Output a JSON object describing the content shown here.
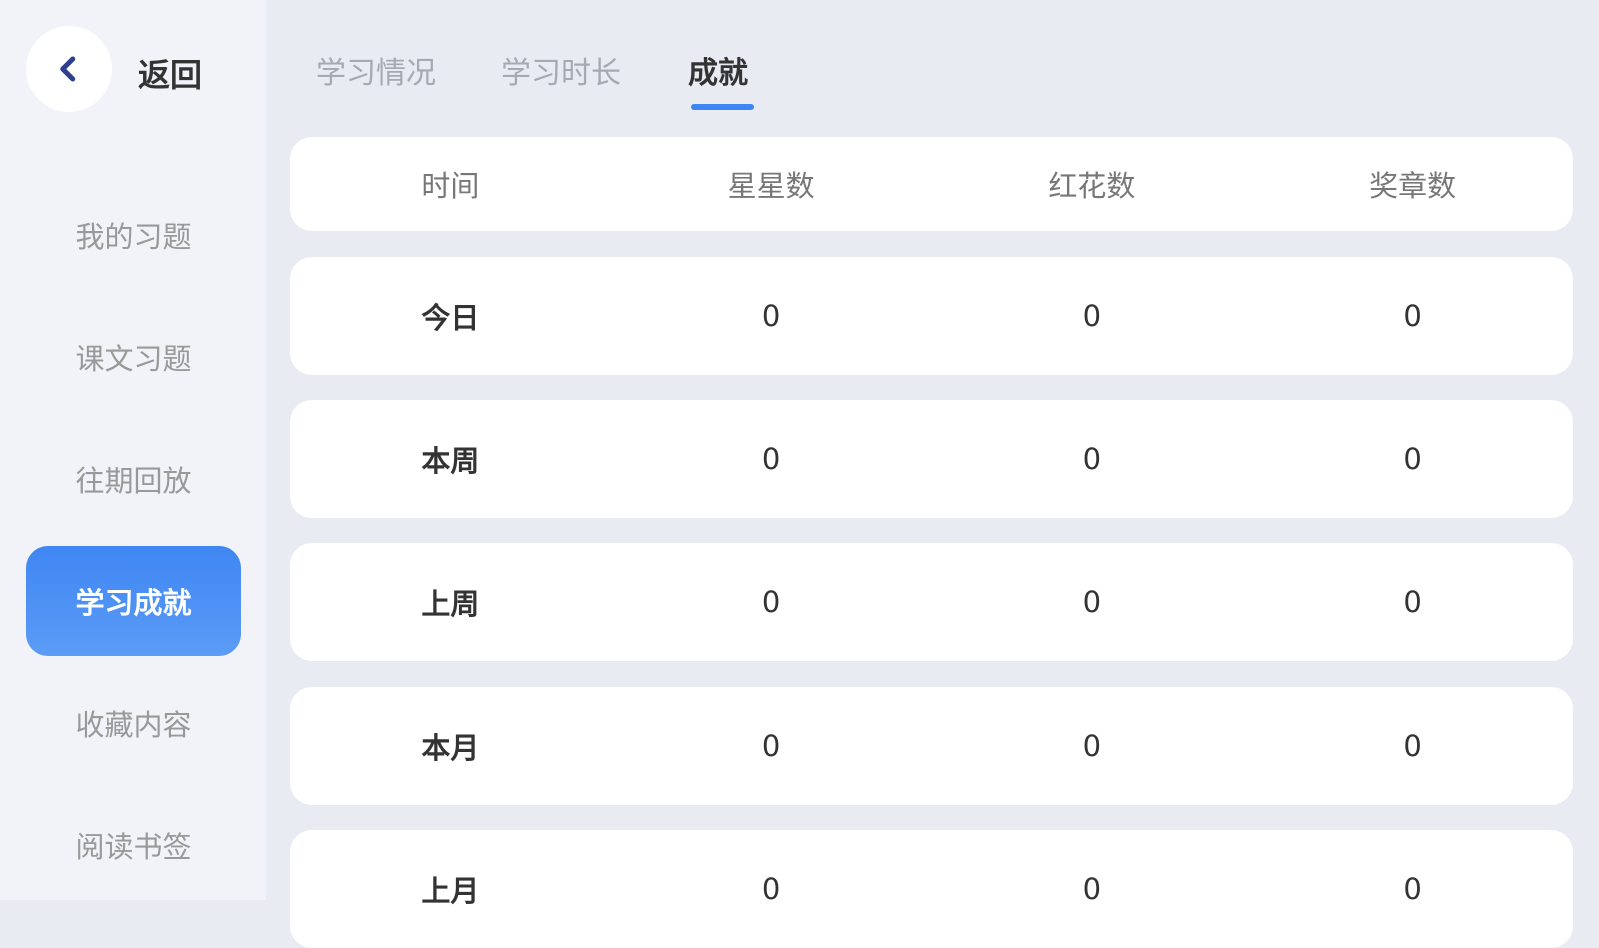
{
  "back_label": "返回",
  "sidebar": {
    "items": [
      {
        "label": "我的习题"
      },
      {
        "label": "课文习题"
      },
      {
        "label": "往期回放"
      },
      {
        "label": "学习成就",
        "active": true
      },
      {
        "label": "收藏内容"
      },
      {
        "label": "阅读书签"
      }
    ]
  },
  "tabs": [
    {
      "label": "学习情况"
    },
    {
      "label": "学习时长"
    },
    {
      "label": "成就",
      "active": true
    }
  ],
  "table": {
    "headers": [
      "时间",
      "星星数",
      "红花数",
      "奖章数"
    ],
    "rows": [
      [
        "今日",
        "0",
        "0",
        "0"
      ],
      [
        "本周",
        "0",
        "0",
        "0"
      ],
      [
        "上周",
        "0",
        "0",
        "0"
      ],
      [
        "本月",
        "0",
        "0",
        "0"
      ],
      [
        "上月",
        "0",
        "0",
        "0"
      ]
    ]
  },
  "colors": {
    "accent": "#3e86f4",
    "back_icon": "#2e3f8f"
  }
}
